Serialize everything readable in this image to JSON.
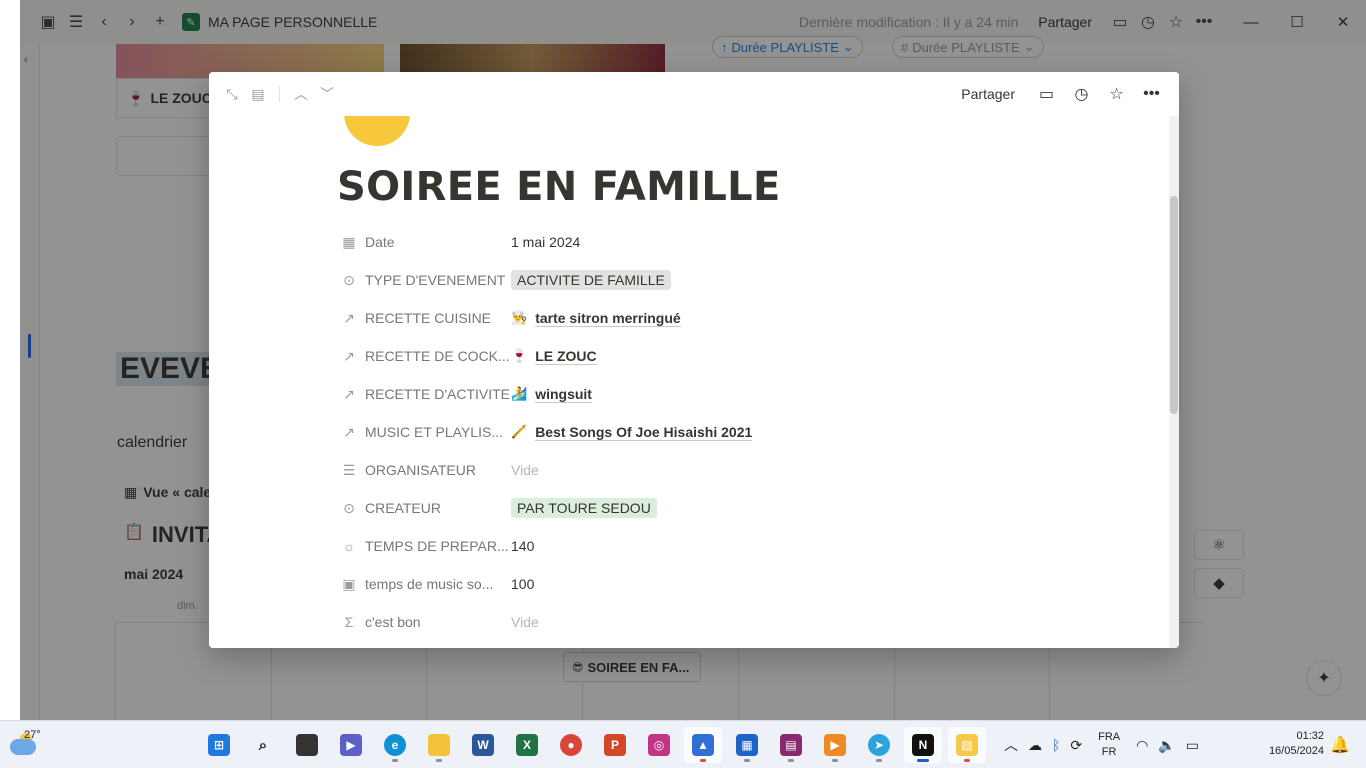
{
  "titlebar": {
    "page_title": "MA PAGE PERSONNELLE",
    "last_modified": "Dernière modification : Il y a 24 min",
    "share_label": "Partager"
  },
  "background": {
    "card_zouc": "LE ZOUC",
    "pill_1": "Durée PLAYLISTE",
    "pill_2": "Durée PLAYLISTE",
    "heading_partial": "EVEVEN",
    "calendar_label": "calendrier",
    "view_label": "Vue « cale",
    "invite_heading": "INVITA",
    "month_label": "mai 2024",
    "day_label": "dim.",
    "event_chip": "SOIREE EN FA..."
  },
  "modal": {
    "share_label": "Partager",
    "title": "SOIREE EN FAMILLE",
    "properties": [
      {
        "name": "Date",
        "icon": "calendar-icon",
        "value": "1 mai 2024"
      },
      {
        "name": "TYPE D'EVENEMENT",
        "icon": "select-icon",
        "value": "ACTIVITE DE FAMILLE",
        "tag_color": "#e3e2e0"
      },
      {
        "name": "RECETTE CUISINE",
        "icon": "relation-arrow-icon",
        "value": "tarte sitron merringué",
        "emoji": "👨‍🍳"
      },
      {
        "name": "RECETTE DE COCK...",
        "icon": "relation-arrow-icon",
        "value": "LE ZOUC",
        "emoji": "🍷"
      },
      {
        "name": "RECETTE D'ACTIVITE",
        "icon": "relation-arrow-icon",
        "value": "wingsuit",
        "emoji": "🏄"
      },
      {
        "name": "MUSIC ET PLAYLIS...",
        "icon": "relation-arrow-icon",
        "value": "Best Songs Of Joe Hisaishi 2021",
        "emoji": "🪈"
      },
      {
        "name": "ORGANISATEUR",
        "icon": "list-icon",
        "value": "Vide"
      },
      {
        "name": "CREATEUR",
        "icon": "select-icon",
        "value": "PAR TOURE SEDOU",
        "tag_color": "#dbeddb"
      },
      {
        "name": "TEMPS DE PREPAR...",
        "icon": "rollup-icon",
        "value": "140"
      },
      {
        "name": "temps de music so...",
        "icon": "rollup-icon",
        "value": "100"
      },
      {
        "name": "c'est bon",
        "icon": "formula-icon",
        "value": "Vide"
      }
    ]
  },
  "taskbar": {
    "temperature": "27°",
    "lang_top": "FRA",
    "lang_bottom": "FR",
    "time": "01:32",
    "date": "16/05/2024"
  },
  "colors": {
    "accent": "#2383e2",
    "text": "#37352f",
    "muted": "#787774",
    "tag_gray": "#e3e2e0",
    "tag_green": "#dbeddb"
  }
}
